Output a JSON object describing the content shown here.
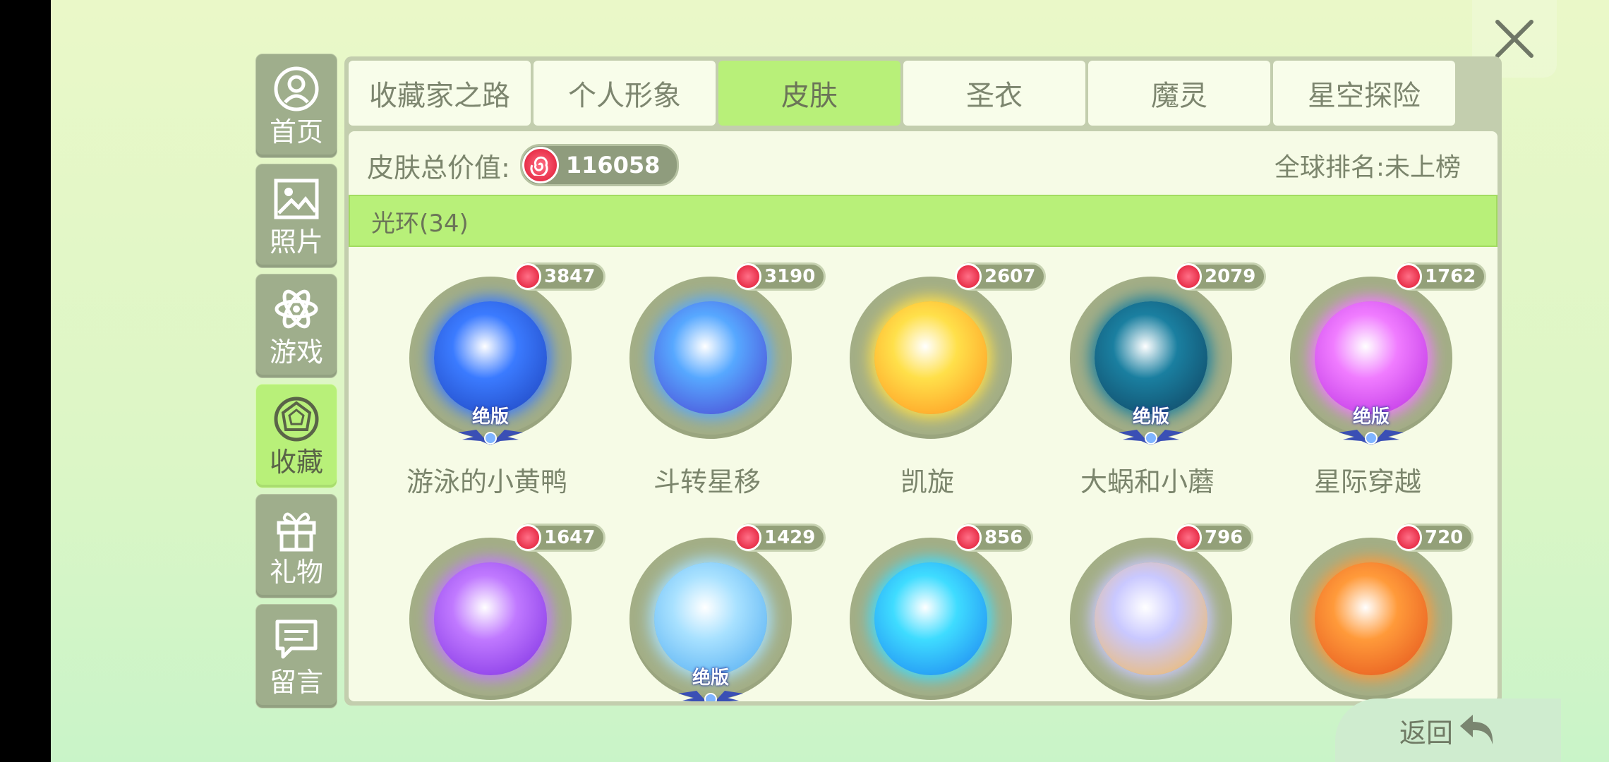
{
  "close_icon": "close-icon",
  "sidebar": {
    "items": [
      {
        "label": "首页",
        "icon": "home-person-icon",
        "active": false
      },
      {
        "label": "照片",
        "icon": "photo-icon",
        "active": false
      },
      {
        "label": "游戏",
        "icon": "atom-icon",
        "active": false
      },
      {
        "label": "收藏",
        "icon": "gem-icon",
        "active": true
      },
      {
        "label": "礼物",
        "icon": "gift-icon",
        "active": false
      },
      {
        "label": "留言",
        "icon": "message-icon",
        "active": false
      }
    ]
  },
  "tabs": [
    {
      "label": "收藏家之路",
      "active": false
    },
    {
      "label": "个人形象",
      "active": false
    },
    {
      "label": "皮肤",
      "active": true
    },
    {
      "label": "圣衣",
      "active": false
    },
    {
      "label": "魔灵",
      "active": false
    },
    {
      "label": "星空探险",
      "active": false
    }
  ],
  "summary": {
    "total_value_label": "皮肤总价值:",
    "total_value": "116058",
    "global_rank": "全球排名:未上榜"
  },
  "category": {
    "label": "光环(34)"
  },
  "items": [
    {
      "name": "游泳的小黄鸭",
      "price": "3847",
      "badge": "绝版",
      "color_inner": "#3b7bff",
      "color_outer": "#1c3fb8"
    },
    {
      "name": "斗转星移",
      "price": "3190",
      "badge": "",
      "color_inner": "#57a8ff",
      "color_outer": "#4a3ccf"
    },
    {
      "name": "凯旋",
      "price": "2607",
      "badge": "",
      "color_inner": "#ffe04a",
      "color_outer": "#ff8f1c"
    },
    {
      "name": "大蜗和小蘑",
      "price": "2079",
      "badge": "绝版",
      "color_inner": "#1a7fa0",
      "color_outer": "#0f3f5c"
    },
    {
      "name": "星际穿越",
      "price": "1762",
      "badge": "绝版",
      "color_inner": "#f07cff",
      "color_outer": "#b72ae0"
    },
    {
      "name": "",
      "price": "1647",
      "badge": "",
      "color_inner": "#c079ff",
      "color_outer": "#7a2be0"
    },
    {
      "name": "",
      "price": "1429",
      "badge": "绝版",
      "color_inner": "#a8e1ff",
      "color_outer": "#4aa8f0"
    },
    {
      "name": "",
      "price": "856",
      "badge": "",
      "color_inner": "#3fdcff",
      "color_outer": "#1a7cf0"
    },
    {
      "name": "",
      "price": "796",
      "badge": "",
      "color_inner": "#c9c8ff",
      "color_outer": "#f8b84a"
    },
    {
      "name": "",
      "price": "720",
      "badge": "",
      "color_inner": "#ff9a3a",
      "color_outer": "#e24e1a"
    }
  ],
  "back_button": {
    "label": "返回",
    "icon": "back-arrow-icon"
  }
}
